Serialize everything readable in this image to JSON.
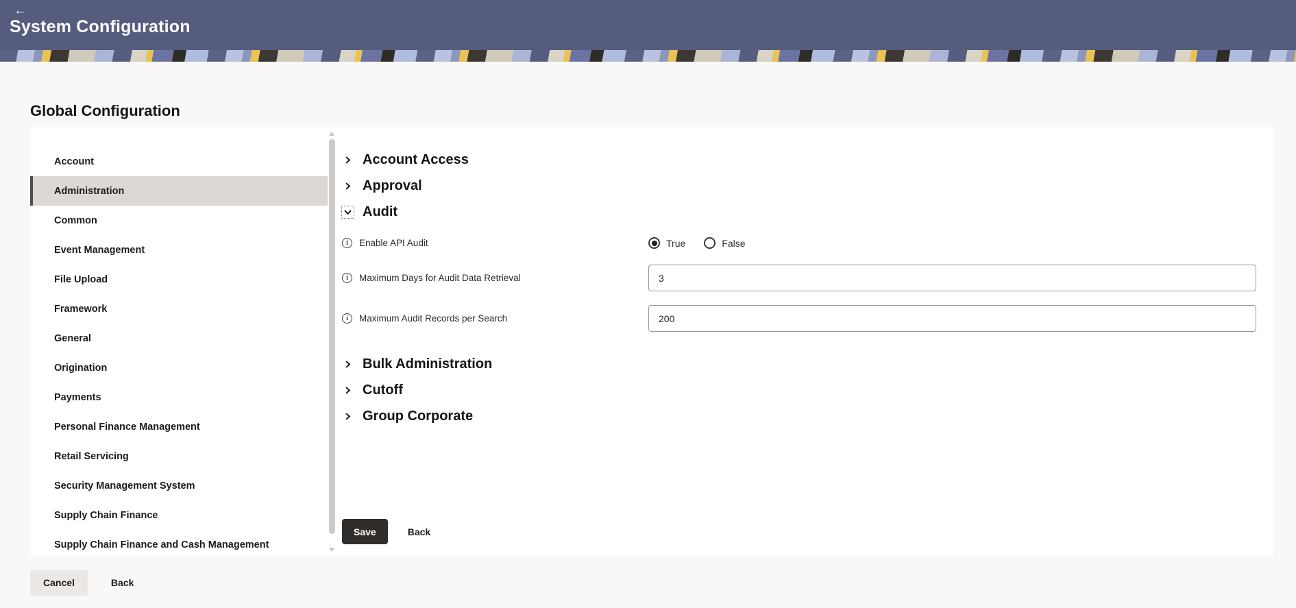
{
  "header": {
    "back_label": "←",
    "title": "System Configuration"
  },
  "page_title": "Global Configuration",
  "icons": {
    "info": "i"
  },
  "sidebar": {
    "items": [
      {
        "label": "Account",
        "selected": false
      },
      {
        "label": "Administration",
        "selected": true
      },
      {
        "label": "Common",
        "selected": false
      },
      {
        "label": "Event Management",
        "selected": false
      },
      {
        "label": "File Upload",
        "selected": false
      },
      {
        "label": "Framework",
        "selected": false
      },
      {
        "label": "General",
        "selected": false
      },
      {
        "label": "Origination",
        "selected": false
      },
      {
        "label": "Payments",
        "selected": false
      },
      {
        "label": "Personal Finance Management",
        "selected": false
      },
      {
        "label": "Retail Servicing",
        "selected": false
      },
      {
        "label": "Security Management System",
        "selected": false
      },
      {
        "label": "Supply Chain Finance",
        "selected": false
      },
      {
        "label": "Supply Chain Finance and Cash Management",
        "selected": false
      }
    ]
  },
  "sections": [
    {
      "label": "Account Access",
      "state": "collapsed"
    },
    {
      "label": "Approval",
      "state": "collapsed"
    },
    {
      "label": "Audit",
      "state": "expanded",
      "fields": [
        {
          "label": "Enable API Audit",
          "type": "radio",
          "options": [
            {
              "label": "True",
              "selected": true
            },
            {
              "label": "False",
              "selected": false
            }
          ]
        },
        {
          "label": "Maximum Days for Audit Data Retrieval",
          "type": "text",
          "value": "3"
        },
        {
          "label": "Maximum Audit Records per Search",
          "type": "text",
          "value": "200"
        }
      ]
    },
    {
      "label": "Bulk Administration",
      "state": "collapsed"
    },
    {
      "label": "Cutoff",
      "state": "collapsed"
    },
    {
      "label": "Group Corporate",
      "state": "collapsed"
    }
  ],
  "panel_actions": {
    "save": "Save",
    "back": "Back"
  },
  "footer_actions": {
    "cancel": "Cancel",
    "back": "Back"
  },
  "colors": {
    "header_bg": "#565C7E",
    "page_bg": "#FAF8F7",
    "panel_bg": "#FFFFFF",
    "selected_item_bg": "#DBD8D5",
    "selected_item_border": "#504C49",
    "primary_button_bg": "#312D2A",
    "secondary_button_bg": "#EBE8E6",
    "input_border": "#97928F",
    "text_dark": "#161513"
  }
}
